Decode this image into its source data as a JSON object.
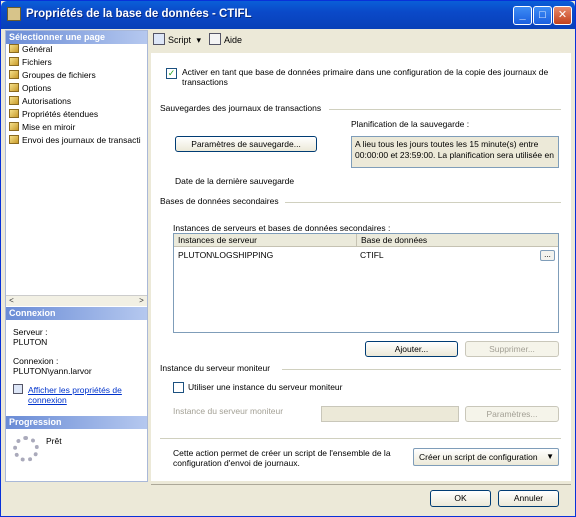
{
  "window": {
    "title": "Propriétés de la base de données - CTIFL",
    "min": "_",
    "max": "□",
    "close": "✕"
  },
  "left": {
    "select_header": "Sélectionner une page",
    "pages": [
      "Général",
      "Fichiers",
      "Groupes de fichiers",
      "Options",
      "Autorisations",
      "Propriétés étendues",
      "Mise en miroir",
      "Envoi des journaux de transacti"
    ],
    "connection_header": "Connexion",
    "server_label": "Serveur :",
    "server_value": "PLUTON",
    "connection_label": "Connexion :",
    "connection_value": "PLUTON\\yann.larvor",
    "link_line1": "Afficher les propriétés de",
    "link_line2": "connexion",
    "progress_header": "Progression",
    "progress_status": "Prêt",
    "scroll_left": "<",
    "scroll_right": ">"
  },
  "toolbar": {
    "script_label": "Script",
    "script_arrow": "▾",
    "help_label": "Aide"
  },
  "primary": {
    "checkbox_line1": "Activer en tant que base de données primaire dans une configuration de la copie des journaux de",
    "checkbox_line2": "transactions",
    "checked": true
  },
  "backups": {
    "section_title": "Sauvegardes des journaux de transactions",
    "settings_button": "Paramètres de sauvegarde...",
    "schedule_label": "Planification de la sauvegarde :",
    "schedule_text": "A lieu tous les jours toutes les 15 minute(s) entre 00:00:00 et 23:59:00. La planification sera utilisée en",
    "last_backup_label": "Date de la dernière sauvegarde"
  },
  "secondary": {
    "section_title": "Bases de données secondaires",
    "grid_label": "Instances de serveurs et bases de données secondaires :",
    "columns": [
      "Instances de serveur",
      "Base de données"
    ],
    "rows": [
      {
        "instance": "PLUTON\\LOGSHIPPING",
        "database": "CTIFL"
      }
    ],
    "ellipsis": "...",
    "add_button": "Ajouter...",
    "remove_button": "Supprimer..."
  },
  "monitor": {
    "section_title": "Instance du serveur moniteur",
    "checkbox_label": "Utiliser une instance du serveur moniteur",
    "checked": false,
    "instance_label": "Instance du serveur moniteur",
    "params_button": "Paramètres..."
  },
  "script_config": {
    "text_line1": "Cette action permet de créer un script de l'ensemble de la",
    "text_line2": "configuration d'envoi de journaux.",
    "dropdown_label": "Créer un script de configuration",
    "dropdown_arrow": "▼"
  },
  "footer": {
    "ok": "OK",
    "cancel": "Annuler"
  },
  "colors": {
    "titlebar": "#0a49c8",
    "face": "#ece9d8",
    "link": "#0033cc"
  }
}
